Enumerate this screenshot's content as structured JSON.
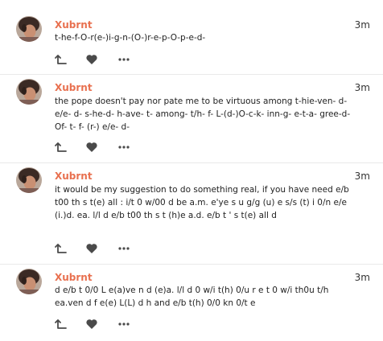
{
  "accent_color": "#e8704f",
  "icons": {
    "reply": "reply-icon",
    "like": "heart-icon",
    "more": "ellipsis-icon"
  },
  "posts": [
    {
      "author": "Xubrnt",
      "time": "3m",
      "text": "t-he-f-O-r(e-)i-g-n-(O-)r-e-p-O-p-e-d-"
    },
    {
      "author": "Xubrnt",
      "time": "3m",
      "text": "the pope doesn't pay nor pate me to be virtuous among t-hie-ven- d- e/e- d- s-he-d- h-ave- t- among- t/h- f- L-(d-)O-c-k- inn-g- e-t-a- gree-d- Of- t- f- (r-) e/e- d-"
    },
    {
      "author": "Xubrnt",
      "time": "3m",
      "text": "it would be my suggestion to do something real, if you have need e/b t00 th s t(e) all : i/t 0 w/00 d be a.m. e'ye s u g/g (u) e s/s (t) i 0/n e/e (i.)d. ea. l/l d e/b t00 th s t (h)e a.d. e/b t ' s t(e) all d"
    },
    {
      "author": "Xubrnt",
      "time": "3m",
      "text": "d e/b t 0/0 L e(a)ve n d (e)a. l/l d 0 w/i t(h) 0/u r e t 0 w/i th0u t/h ea.ven d f e(e) L(L) d h and e/b t(h) 0/0 kn 0/t e"
    }
  ]
}
